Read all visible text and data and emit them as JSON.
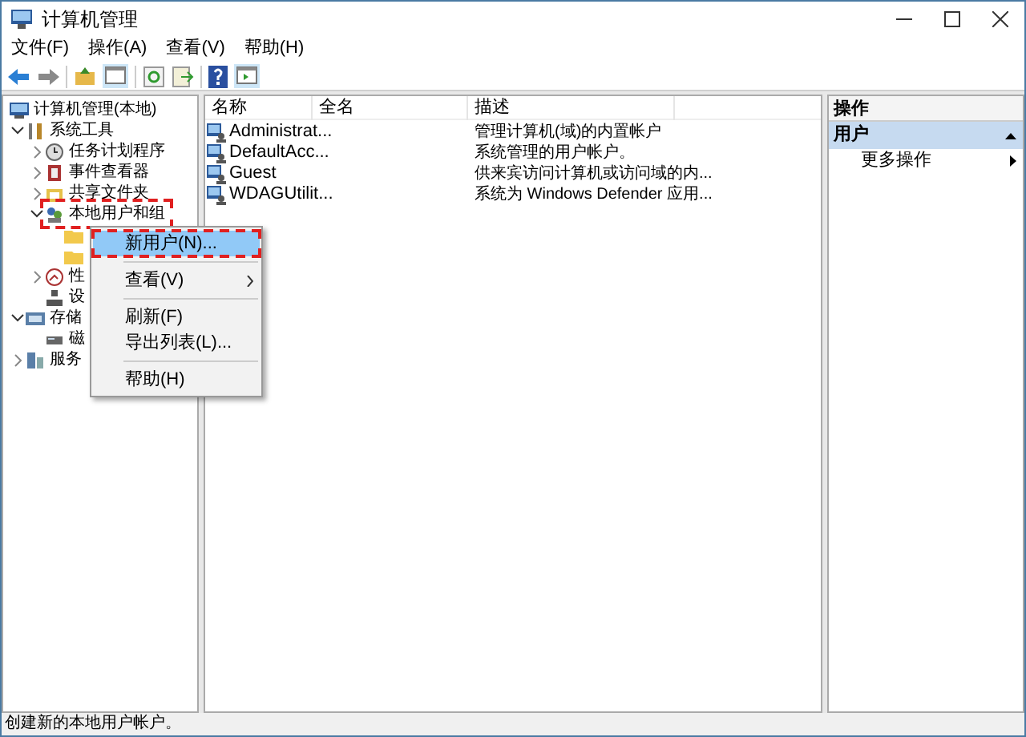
{
  "window": {
    "title": "计算机管理"
  },
  "menu_bar": [
    "文件(F)",
    "操作(A)",
    "查看(V)",
    "帮助(H)"
  ],
  "tree": [
    {
      "label": "计算机管理(本地)",
      "children": [
        {
          "label": "系统工具",
          "expanded": true,
          "children": [
            {
              "label": "任务计划程序",
              "expanded": false
            },
            {
              "label": "事件查看器",
              "expanded": false
            },
            {
              "label": "共享文件夹",
              "expanded": false
            },
            {
              "label": "本地用户和组",
              "expanded": true,
              "highlighted": true,
              "children": [
                {
                  "kind": "folder"
                },
                {
                  "kind": "folder"
                }
              ]
            },
            {
              "label": "性",
              "expanded": false
            },
            {
              "label": "设"
            }
          ]
        },
        {
          "label": "存储",
          "expanded": true,
          "children": [
            {
              "label": "磁"
            }
          ]
        },
        {
          "label": "服务",
          "expanded": false
        }
      ]
    }
  ],
  "table": {
    "columns": [
      "名称",
      "全名",
      "描述"
    ],
    "rows": [
      {
        "name": "Administrat...",
        "full_name": "",
        "description": "管理计算机(域)的内置帐户"
      },
      {
        "name": "DefaultAcc...",
        "full_name": "",
        "description": "系统管理的用户帐户。"
      },
      {
        "name": "Guest",
        "full_name": "",
        "description": "供来宾访问计算机或访问域的内..."
      },
      {
        "name": "WDAGUtilit...",
        "full_name": "",
        "description": "系统为 Windows Defender 应用..."
      }
    ]
  },
  "actions": {
    "title": "操作",
    "section": "用户",
    "items": [
      "更多操作"
    ]
  },
  "context_menu": [
    {
      "kind": "item",
      "label": "新用户(N)...",
      "selected": true,
      "highlighted": true,
      "submenu": false
    },
    {
      "kind": "separator"
    },
    {
      "kind": "item",
      "label": "查看(V)",
      "selected": false,
      "submenu": true
    },
    {
      "kind": "separator"
    },
    {
      "kind": "item",
      "label": "刷新(F)",
      "selected": false,
      "submenu": false
    },
    {
      "kind": "item",
      "label": "导出列表(L)...",
      "selected": false,
      "submenu": false
    },
    {
      "kind": "separator"
    },
    {
      "kind": "item",
      "label": "帮助(H)",
      "selected": false,
      "submenu": false
    }
  ],
  "status_bar": "创建新的本地用户帐户。"
}
